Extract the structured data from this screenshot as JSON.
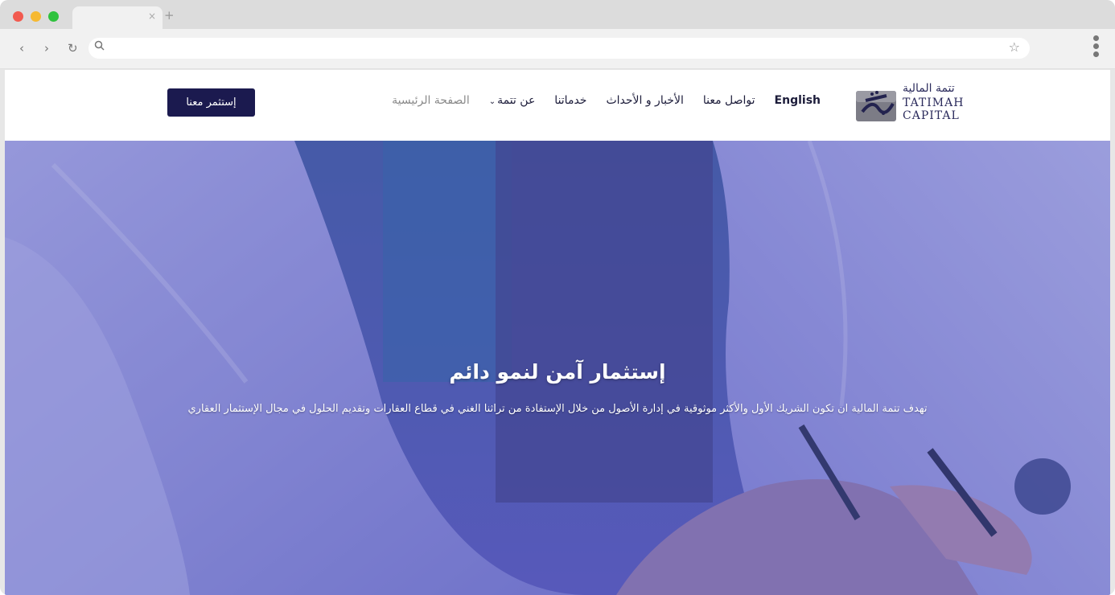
{
  "browser": {
    "nav": {
      "back": "‹",
      "forward": "›",
      "reload": "↻"
    },
    "url_icon": "search-icon",
    "new_tab": "+",
    "tab_close": "×",
    "star_icon": "☆"
  },
  "site": {
    "logo": {
      "arabic": "تتمة المالية",
      "en_line1": "TATIMAH",
      "en_line2": "CAPITAL"
    },
    "nav": {
      "home": "الصفحة الرئيسية",
      "about": "عن تتمة",
      "services": "خدماتنا",
      "news": "الأخبار و الأحداث",
      "contact": "تواصل معنا",
      "language": "English"
    },
    "cta": "إستثمر معنا"
  },
  "hero": {
    "title": "إستثمار آمن لنمو دائم",
    "subtitle": "تهدف تتمة المالية ان تكون الشريك الأول والأكثر موثوقية في إدارة الأصول من خلال الإستفادة من تراثنا الغني في قطاع العقارات وتقديم الحلول في مجال الإستثمار العقاري"
  },
  "colors": {
    "brand_navy": "#1b1a4f",
    "hero_overlay": "#5a5ab8",
    "nav_text": "#1c1c3a",
    "nav_home": "#8a8a8a"
  }
}
